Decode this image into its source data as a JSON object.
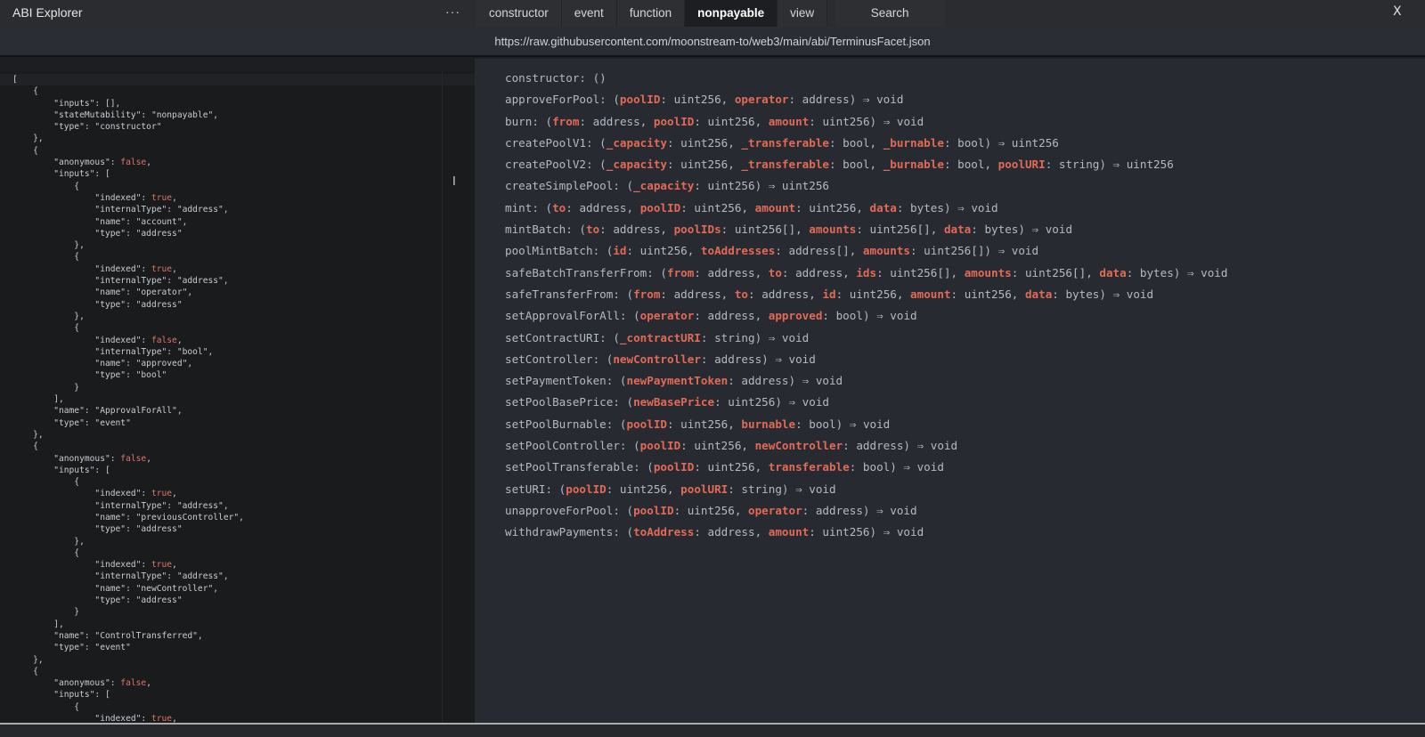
{
  "window": {
    "title": "ABI Explorer",
    "menu_icon": "more-horizontal-icon",
    "menu_label": "···",
    "close_icon": "close-icon",
    "close_label": "X"
  },
  "tabs": [
    {
      "label": "constructor",
      "active": false
    },
    {
      "label": "event",
      "active": false
    },
    {
      "label": "function",
      "active": false
    },
    {
      "label": "nonpayable",
      "active": true
    },
    {
      "label": "view",
      "active": false
    }
  ],
  "search": {
    "label": "Search"
  },
  "url": "https://raw.githubusercontent.com/moonstream-to/web3/main/abi/TerminusFacet.json",
  "json_lines": [
    "[",
    "    {",
    "        \"inputs\": [],",
    "        \"stateMutability\": \"nonpayable\",",
    "        \"type\": \"constructor\"",
    "    },",
    "    {",
    "        \"anonymous\": false,",
    "        \"inputs\": [",
    "            {",
    "                \"indexed\": true,",
    "                \"internalType\": \"address\",",
    "                \"name\": \"account\",",
    "                \"type\": \"address\"",
    "            },",
    "            {",
    "                \"indexed\": true,",
    "                \"internalType\": \"address\",",
    "                \"name\": \"operator\",",
    "                \"type\": \"address\"",
    "            },",
    "            {",
    "                \"indexed\": false,",
    "                \"internalType\": \"bool\",",
    "                \"name\": \"approved\",",
    "                \"type\": \"bool\"",
    "            }",
    "        ],",
    "        \"name\": \"ApprovalForAll\",",
    "        \"type\": \"event\"",
    "    },",
    "    {",
    "        \"anonymous\": false,",
    "        \"inputs\": [",
    "            {",
    "                \"indexed\": true,",
    "                \"internalType\": \"address\",",
    "                \"name\": \"previousController\",",
    "                \"type\": \"address\"",
    "            },",
    "            {",
    "                \"indexed\": true,",
    "                \"internalType\": \"address\",",
    "                \"name\": \"newController\",",
    "                \"type\": \"address\"",
    "            }",
    "        ],",
    "        \"name\": \"ControlTransferred\",",
    "        \"type\": \"event\"",
    "    },",
    "    {",
    "        \"anonymous\": false,",
    "        \"inputs\": [",
    "            {",
    "                \"indexed\": true,"
  ],
  "signatures": [
    {
      "name": "constructor",
      "params": [],
      "returns": ""
    },
    {
      "name": "approveForPool",
      "params": [
        {
          "name": "poolID",
          "type": "uint256"
        },
        {
          "name": "operator",
          "type": "address"
        }
      ],
      "returns": "void"
    },
    {
      "name": "burn",
      "params": [
        {
          "name": "from",
          "type": "address"
        },
        {
          "name": "poolID",
          "type": "uint256"
        },
        {
          "name": "amount",
          "type": "uint256"
        }
      ],
      "returns": "void"
    },
    {
      "name": "createPoolV1",
      "params": [
        {
          "name": "_capacity",
          "type": "uint256"
        },
        {
          "name": "_transferable",
          "type": "bool"
        },
        {
          "name": "_burnable",
          "type": "bool"
        }
      ],
      "returns": "uint256"
    },
    {
      "name": "createPoolV2",
      "params": [
        {
          "name": "_capacity",
          "type": "uint256"
        },
        {
          "name": "_transferable",
          "type": "bool"
        },
        {
          "name": "_burnable",
          "type": "bool"
        },
        {
          "name": "poolURI",
          "type": "string"
        }
      ],
      "returns": "uint256"
    },
    {
      "name": "createSimplePool",
      "params": [
        {
          "name": "_capacity",
          "type": "uint256"
        }
      ],
      "returns": "uint256"
    },
    {
      "name": "mint",
      "params": [
        {
          "name": "to",
          "type": "address"
        },
        {
          "name": "poolID",
          "type": "uint256"
        },
        {
          "name": "amount",
          "type": "uint256"
        },
        {
          "name": "data",
          "type": "bytes"
        }
      ],
      "returns": "void"
    },
    {
      "name": "mintBatch",
      "params": [
        {
          "name": "to",
          "type": "address"
        },
        {
          "name": "poolIDs",
          "type": "uint256[]"
        },
        {
          "name": "amounts",
          "type": "uint256[]"
        },
        {
          "name": "data",
          "type": "bytes"
        }
      ],
      "returns": "void"
    },
    {
      "name": "poolMintBatch",
      "params": [
        {
          "name": "id",
          "type": "uint256"
        },
        {
          "name": "toAddresses",
          "type": "address[]"
        },
        {
          "name": "amounts",
          "type": "uint256[]"
        }
      ],
      "returns": "void"
    },
    {
      "name": "safeBatchTransferFrom",
      "params": [
        {
          "name": "from",
          "type": "address"
        },
        {
          "name": "to",
          "type": "address"
        },
        {
          "name": "ids",
          "type": "uint256[]"
        },
        {
          "name": "amounts",
          "type": "uint256[]"
        },
        {
          "name": "data",
          "type": "bytes"
        }
      ],
      "returns": "void"
    },
    {
      "name": "safeTransferFrom",
      "params": [
        {
          "name": "from",
          "type": "address"
        },
        {
          "name": "to",
          "type": "address"
        },
        {
          "name": "id",
          "type": "uint256"
        },
        {
          "name": "amount",
          "type": "uint256"
        },
        {
          "name": "data",
          "type": "bytes"
        }
      ],
      "returns": "void"
    },
    {
      "name": "setApprovalForAll",
      "params": [
        {
          "name": "operator",
          "type": "address"
        },
        {
          "name": "approved",
          "type": "bool"
        }
      ],
      "returns": "void"
    },
    {
      "name": "setContractURI",
      "params": [
        {
          "name": "_contractURI",
          "type": "string"
        }
      ],
      "returns": "void"
    },
    {
      "name": "setController",
      "params": [
        {
          "name": "newController",
          "type": "address"
        }
      ],
      "returns": "void"
    },
    {
      "name": "setPaymentToken",
      "params": [
        {
          "name": "newPaymentToken",
          "type": "address"
        }
      ],
      "returns": "void"
    },
    {
      "name": "setPoolBasePrice",
      "params": [
        {
          "name": "newBasePrice",
          "type": "uint256"
        }
      ],
      "returns": "void"
    },
    {
      "name": "setPoolBurnable",
      "params": [
        {
          "name": "poolID",
          "type": "uint256"
        },
        {
          "name": "burnable",
          "type": "bool"
        }
      ],
      "returns": "void"
    },
    {
      "name": "setPoolController",
      "params": [
        {
          "name": "poolID",
          "type": "uint256"
        },
        {
          "name": "newController",
          "type": "address"
        }
      ],
      "returns": "void"
    },
    {
      "name": "setPoolTransferable",
      "params": [
        {
          "name": "poolID",
          "type": "uint256"
        },
        {
          "name": "transferable",
          "type": "bool"
        }
      ],
      "returns": "void"
    },
    {
      "name": "setURI",
      "params": [
        {
          "name": "poolID",
          "type": "uint256"
        },
        {
          "name": "poolURI",
          "type": "string"
        }
      ],
      "returns": "void"
    },
    {
      "name": "unapproveForPool",
      "params": [
        {
          "name": "poolID",
          "type": "uint256"
        },
        {
          "name": "operator",
          "type": "address"
        }
      ],
      "returns": "void"
    },
    {
      "name": "withdrawPayments",
      "params": [
        {
          "name": "toAddress",
          "type": "address"
        },
        {
          "name": "amount",
          "type": "uint256"
        }
      ],
      "returns": "void"
    }
  ],
  "colors": {
    "param_name": "#e36a55",
    "json_boolean": "#e0736a",
    "text": "#b3bac4",
    "active_tab": "#1c1e22"
  },
  "cursor_icon": "text-cursor-icon",
  "cursor_glyph": "I"
}
